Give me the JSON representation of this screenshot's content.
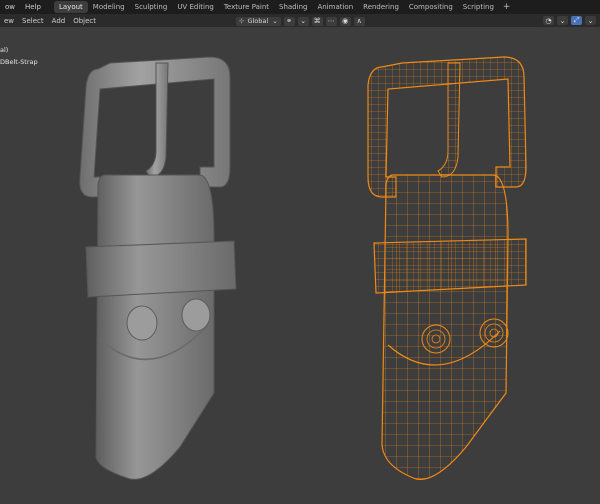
{
  "app": {
    "menu": [
      "ow",
      "Help"
    ],
    "workspace_tabs": [
      {
        "label": "Layout",
        "active": true
      },
      {
        "label": "Modeling",
        "active": false
      },
      {
        "label": "Sculpting",
        "active": false
      },
      {
        "label": "UV Editing",
        "active": false
      },
      {
        "label": "Texture Paint",
        "active": false
      },
      {
        "label": "Shading",
        "active": false
      },
      {
        "label": "Animation",
        "active": false
      },
      {
        "label": "Rendering",
        "active": false
      },
      {
        "label": "Compositing",
        "active": false
      },
      {
        "label": "Scripting",
        "active": false
      }
    ],
    "add_tab": "+"
  },
  "viewport_header": {
    "menus": [
      "ew",
      "Select",
      "Add",
      "Object"
    ],
    "orientation": "Global"
  },
  "outliner": {
    "lines": [
      "al)",
      "DBelt-Strap"
    ]
  },
  "colors": {
    "background": "#3d3d3d",
    "wire": "#f08a16",
    "mesh": "#8a8a8a"
  }
}
